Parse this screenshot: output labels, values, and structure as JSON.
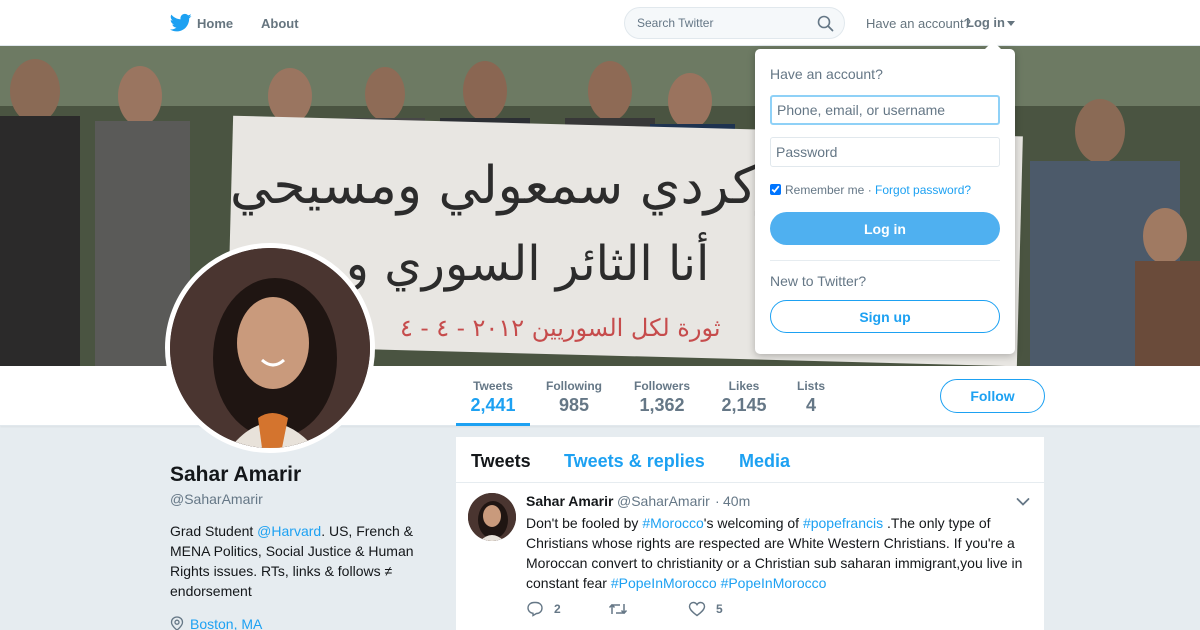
{
  "nav": {
    "home_label": "Home",
    "about_label": "About",
    "search_placeholder": "Search Twitter",
    "have_account": "Have an account?",
    "login_label": "Log in",
    "brand_color": "#1da1f2"
  },
  "banner": {
    "line1": "سني وكردي سمعولي ومسيحي",
    "line2": "أنا الثائر السوري و...",
    "line3": "ثورة لكل السوريين ٢٠١٢ - ٤ - ٤"
  },
  "profile": {
    "name": "Sahar Amarir",
    "handle": "@SaharAmarir",
    "bio_prefix": "Grad Student ",
    "bio_link": "@Harvard",
    "bio_suffix": ". US, French & MENA Politics, Social Justice & Human Rights issues. RTs, links & follows ≠ endorsement",
    "location": "Boston, MA"
  },
  "stats": [
    {
      "label": "Tweets",
      "value": "2,441"
    },
    {
      "label": "Following",
      "value": "985"
    },
    {
      "label": "Followers",
      "value": "1,362"
    },
    {
      "label": "Likes",
      "value": "2,145"
    },
    {
      "label": "Lists",
      "value": "4"
    }
  ],
  "follow_label": "Follow",
  "timeline": {
    "tabs": [
      "Tweets",
      "Tweets & replies",
      "Media"
    ],
    "tweet": {
      "name": "Sahar Amarir",
      "handle": "@SaharAmarir",
      "dot": "·",
      "time": "40m",
      "t1": "Don't be fooled by ",
      "h1": "#Morocco",
      "t2": "'s welcoming of ",
      "h2": "#popefrancis",
      "t3": " .The only type of Christians whose rights are respected are White Western Christians. If you're a Moroccan convert to christianity or a Christian sub saharan immigrant,you live in constant fear ",
      "h3": "#PopeInMorocco",
      "h4": "#PopeInMorocco",
      "replies": "2",
      "retweets": "",
      "likes": "5"
    }
  },
  "login_dropdown": {
    "title": "Have an account?",
    "user_placeholder": "Phone, email, or username",
    "pass_placeholder": "Password",
    "remember": "Remember me",
    "sep": " · ",
    "forgot": "Forgot password?",
    "login_button": "Log in",
    "new_to": "New to Twitter?",
    "signup_button": "Sign up"
  }
}
